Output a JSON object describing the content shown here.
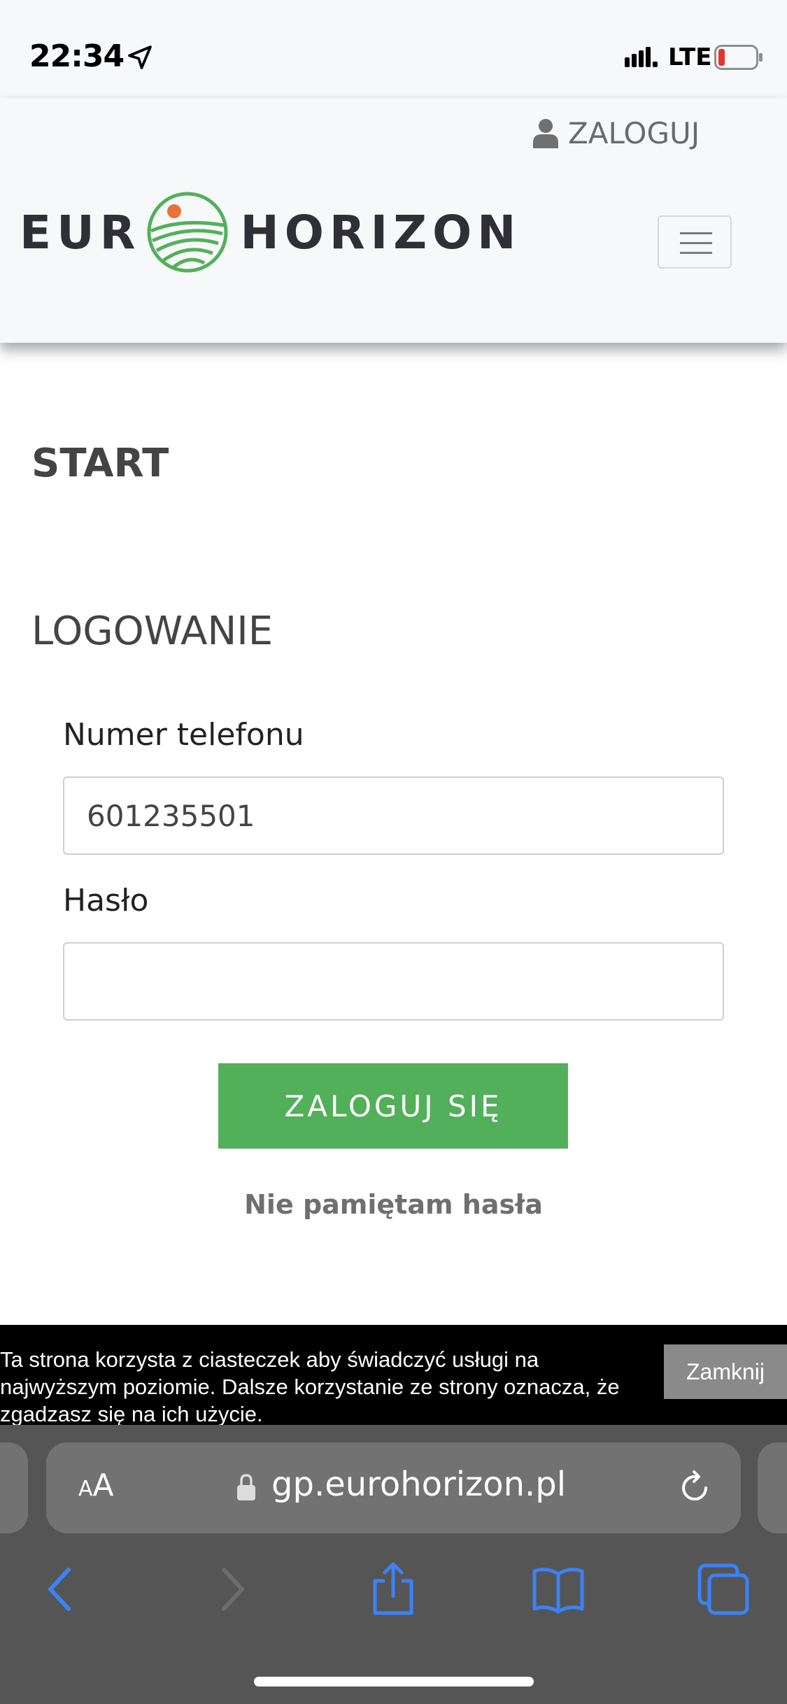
{
  "status_bar": {
    "time": "22:34",
    "network": "LTE"
  },
  "header": {
    "login_link": "ZALOGUJ",
    "logo_left": "EUR",
    "logo_right": "HORIZON"
  },
  "main": {
    "start_heading": "START",
    "login_heading": "LOGOWANIE",
    "phone_label": "Numer telefonu",
    "phone_value": "601235501",
    "password_label": "Hasło",
    "password_value": "",
    "submit_label": "ZALOGUJ SIĘ",
    "forgot_link": "Nie pamiętam hasła"
  },
  "cookie_bar": {
    "text": "Ta strona korzysta z ciasteczek aby świadczyć usługi na najwyższym poziomie. Dalsze korzystanie ze strony oznacza, że zgadzasz się na ich użycie.",
    "close_label": "Zamknij"
  },
  "browser": {
    "aa_small": "A",
    "aa_large": "A",
    "url": "gp.eurohorizon.pl"
  },
  "colors": {
    "accent_green": "#52b05a",
    "logo_orange": "#e8743b",
    "header_bg": "#f7f8fa",
    "browser_bg": "#555555",
    "ios_blue": "#3b82f6"
  }
}
